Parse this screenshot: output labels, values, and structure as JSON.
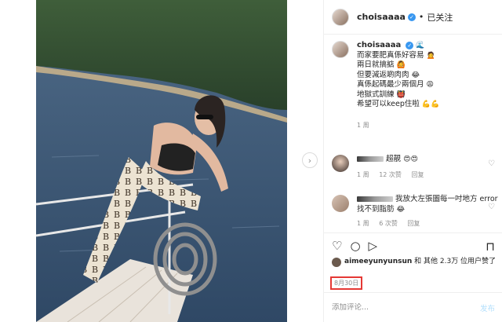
{
  "post": {
    "username": "choisaaaa",
    "follow_state": "已关注",
    "separator": "•"
  },
  "caption": {
    "username": "choisaaaa",
    "lines": [
      "而家要肥真係好容易",
      "兩日就搞掂",
      "但要減返啲肉肉",
      "真係起碼最少兩個月",
      "地獄式訓練",
      "希望可以keep住啦"
    ],
    "time": "1 周"
  },
  "comments": [
    {
      "text": "超靚",
      "emoji": "😍😍",
      "time": "1 周",
      "likes": "12 次赞",
      "reply": "回复"
    },
    {
      "text": "我放大左張圖每一吋地方 error 找不到脂肪",
      "emoji": "😂",
      "time": "1 周",
      "likes": "6 次赞",
      "reply": "回复"
    }
  ],
  "likes": {
    "liker": "aimeeyunyunsun",
    "rest": "和 其他 2.3万 位用户赞了"
  },
  "date": "8月30日",
  "comment_box": {
    "placeholder": "添加评论...",
    "post_label": "发布"
  },
  "icons": {
    "like": "heart-icon",
    "comment": "comment-icon",
    "share": "share-icon",
    "save": "bookmark-icon",
    "next": "chevron-right-icon"
  }
}
